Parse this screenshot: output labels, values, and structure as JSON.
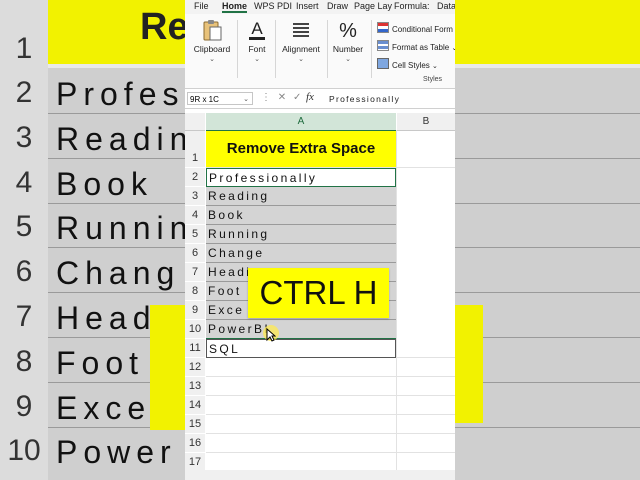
{
  "background": {
    "title": "Remo",
    "row_numbers": [
      "1",
      "2",
      "3",
      "4",
      "5",
      "6",
      "7",
      "8",
      "9",
      "10"
    ],
    "cells": [
      "Profes",
      "Readin",
      "Book",
      "Runnin",
      "Chang",
      "Headi",
      "Foot",
      "Exce",
      "Power"
    ]
  },
  "menu": {
    "items": [
      "File",
      "Home",
      "WPS PDI",
      "Insert",
      "Draw",
      "Page Lay",
      "Formula:",
      "Data"
    ],
    "active": "Home"
  },
  "ribbon": {
    "clipboard": "Clipboard",
    "font": "Font",
    "alignment": "Alignment",
    "number": "Number",
    "number_icon": "%",
    "conditional": "Conditional Form",
    "format_table": "Format as Table",
    "cell_styles": "Cell Styles",
    "styles_label": "Styles"
  },
  "formula_bar": {
    "name_box": "9R x 1C",
    "fx": "fx",
    "content": "Professionally"
  },
  "sheet": {
    "col_a": "A",
    "col_b": "B",
    "title_cell": "Remove Extra Space",
    "rows": [
      "1",
      "2",
      "3",
      "4",
      "5",
      "6",
      "7",
      "8",
      "9",
      "10",
      "11",
      "12",
      "13",
      "14",
      "15",
      "16",
      "17"
    ],
    "values": [
      "Professionally",
      "Reading",
      "Book",
      "Running",
      "Change",
      "Heading",
      "Foot",
      "Exce",
      "PowerBI",
      "SQL"
    ]
  },
  "overlay": {
    "shortcut": "CTRL H"
  },
  "colors": {
    "accent": "#217346",
    "title_fill": "#ffff00",
    "selection_fill": "#d4d4d4"
  }
}
